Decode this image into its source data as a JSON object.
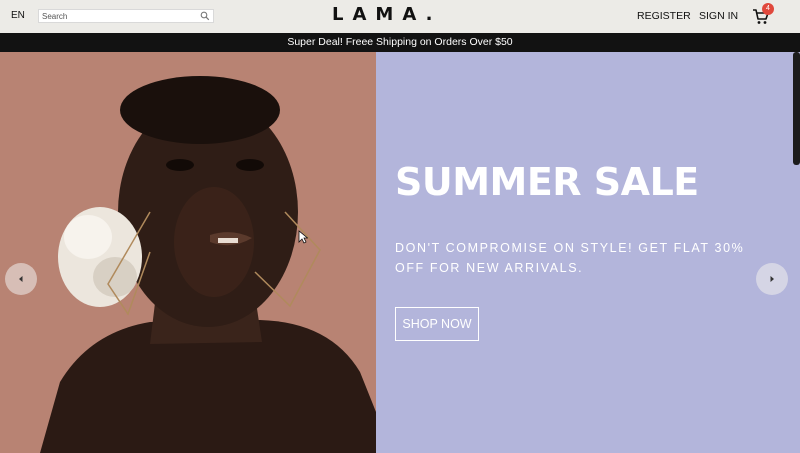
{
  "navbar": {
    "language": "EN",
    "search_placeholder": "Search",
    "logo": "LAMA.",
    "register_label": "REGISTER",
    "signin_label": "SIGN IN",
    "cart_count": "4",
    "icons": [
      "search-icon",
      "cart-icon"
    ]
  },
  "announcement": {
    "text": "Super Deal! Freee Shipping on Orders Over $50"
  },
  "slider": {
    "title": "SUMMER SALE",
    "description": "DON'T COMPROMISE ON STYLE! GET FLAT 30% OFF FOR NEW ARRIVALS.",
    "button_label": "SHOP NOW",
    "background_color": "#b3b5db",
    "image_background_color": "#b88373",
    "icons": [
      "arrow-left-icon",
      "arrow-right-icon"
    ]
  },
  "colors": {
    "navbar_bg": "#ecebe7",
    "announcement_bg": "#121212",
    "badge": "#e0483c"
  }
}
